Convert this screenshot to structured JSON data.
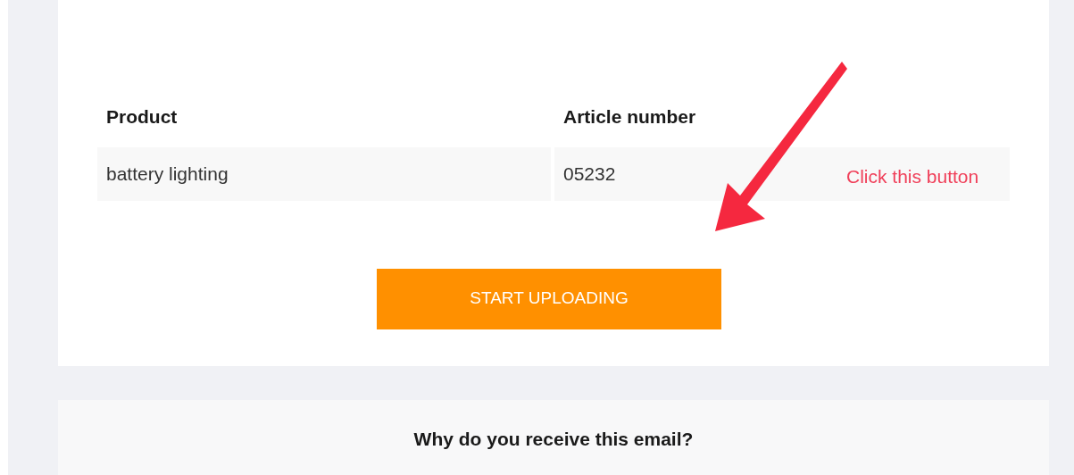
{
  "table": {
    "columns": [
      "Product",
      "Article number"
    ],
    "rows": [
      [
        "battery lighting",
        "05232"
      ]
    ]
  },
  "button": {
    "label": "START UPLOADING"
  },
  "annotation": {
    "text": "Click this button"
  },
  "footer": {
    "heading": "Why do you receive this email?"
  }
}
